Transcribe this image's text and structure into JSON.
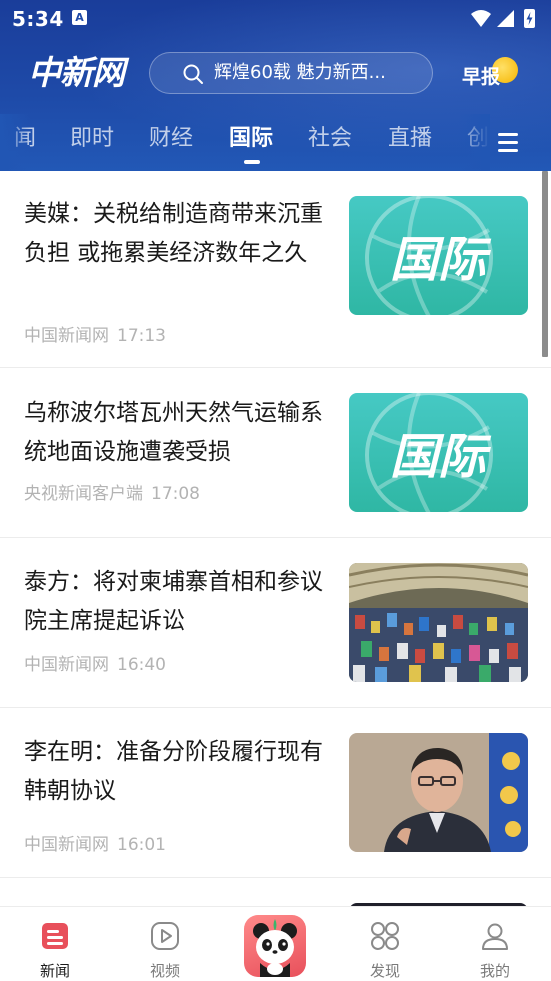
{
  "status_bar": {
    "time": "5:34",
    "notification_icon": "A"
  },
  "header": {
    "logo": "中新网",
    "search_placeholder": "辉煌60载 魅力新西...",
    "zaobao_label": "早报"
  },
  "tabs": [
    {
      "label": "闻"
    },
    {
      "label": "即时"
    },
    {
      "label": "财经"
    },
    {
      "label": "国际",
      "active": true
    },
    {
      "label": "社会"
    },
    {
      "label": "直播"
    },
    {
      "label": "创"
    }
  ],
  "articles": [
    {
      "title": "美媒：关税给制造商带来沉重负担 或拖累美经济数年之久",
      "source": "中国新闻网",
      "time": "17:13",
      "thumb_label": "国际"
    },
    {
      "title": "乌称波尔塔瓦州天然气运输系统地面设施遭袭受损",
      "source": "央视新闻客户端",
      "time": "17:08",
      "thumb_label": "国际"
    },
    {
      "title": "泰方：将对柬埔寨首相和参议院主席提起诉讼",
      "source": "中国新闻网",
      "time": "16:40"
    },
    {
      "title": "李在明：准备分阶段履行现有韩朝协议",
      "source": "中国新闻网",
      "time": "16:01"
    }
  ],
  "bottom_nav": [
    {
      "label": "新闻",
      "icon": "news-icon",
      "active": true
    },
    {
      "label": "视频",
      "icon": "video-icon"
    },
    {
      "label": "",
      "icon": "panda-icon"
    },
    {
      "label": "发现",
      "icon": "discover-icon"
    },
    {
      "label": "我的",
      "icon": "profile-icon"
    }
  ],
  "colors": {
    "header_blue": "#1e4aa8",
    "accent_red": "#e8505b",
    "thumb_teal": "#3dbfb4",
    "meta_gray": "#b3b3b3"
  }
}
